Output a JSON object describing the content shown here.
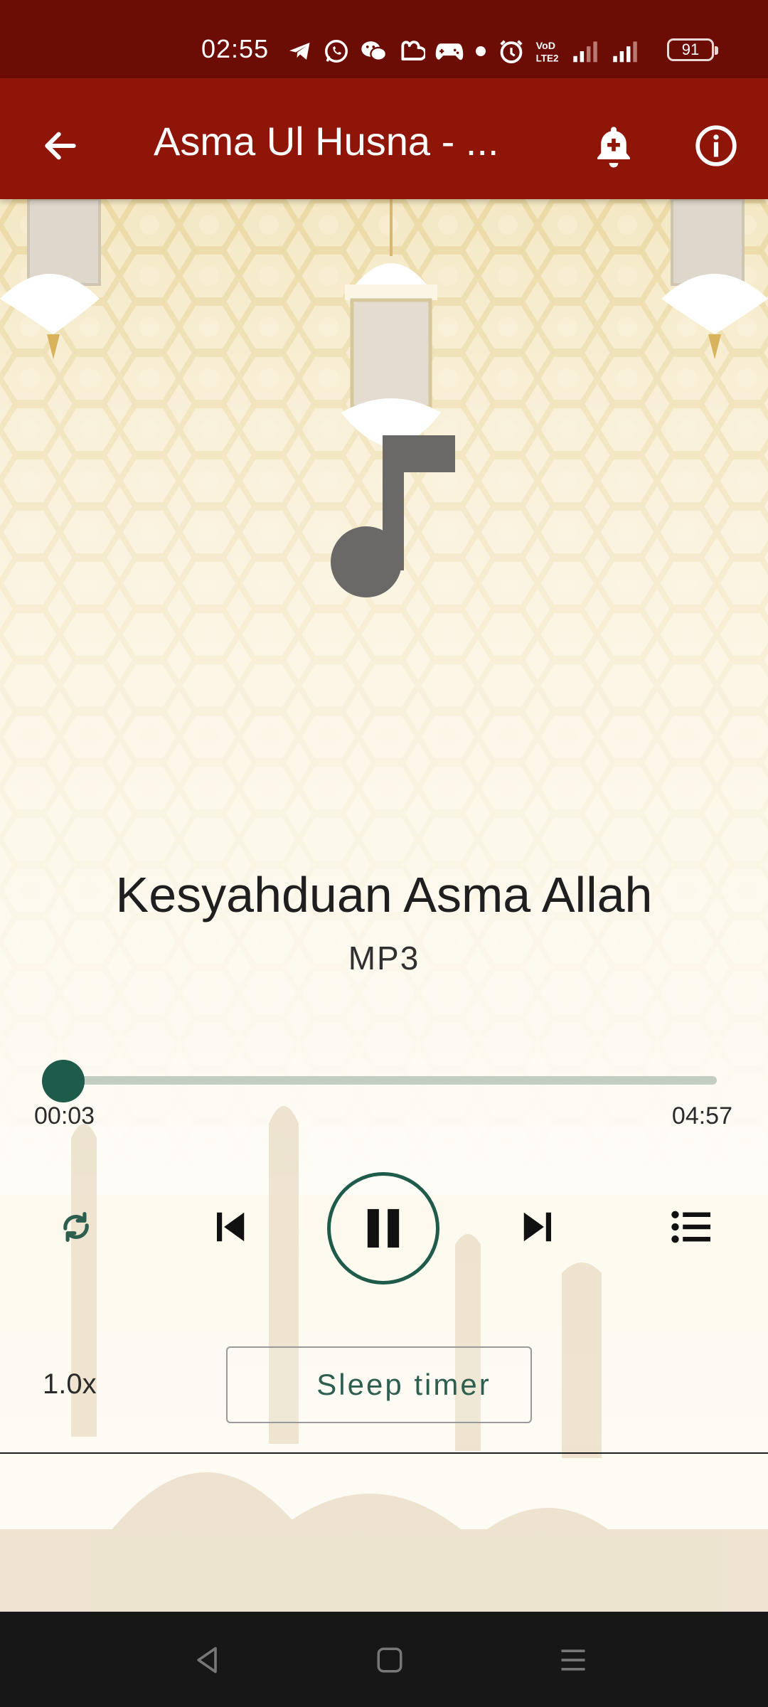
{
  "status_bar": {
    "time": "02:55",
    "battery": "91",
    "icons": [
      "telegram-icon",
      "whatsapp-icon",
      "wechat-icon",
      "cloud-icon",
      "gamepad-icon",
      "dot-icon",
      "alarm-icon",
      "volte-icon",
      "signal-icon",
      "signal-icon"
    ]
  },
  "app_bar": {
    "title": "Asma Ul Husna - ...",
    "back_icon": "arrow-left-icon",
    "bell_icon": "bell-plus-icon",
    "info_icon": "info-icon"
  },
  "player": {
    "track_title": "Kesyahduan Asma Allah",
    "format": "MP3",
    "current_time": "00:03",
    "total_time": "04:57",
    "progress": 0.01,
    "speed": "1.0x",
    "sleep_timer_label": "Sleep timer"
  },
  "colors": {
    "status_bar": "#6c0d05",
    "app_bar": "#8f1508",
    "accent": "#1f5b4a",
    "nav_bar": "#171717"
  },
  "nav_bar": {
    "icons": [
      "nav-back-icon",
      "nav-home-icon",
      "nav-menu-icon"
    ]
  }
}
